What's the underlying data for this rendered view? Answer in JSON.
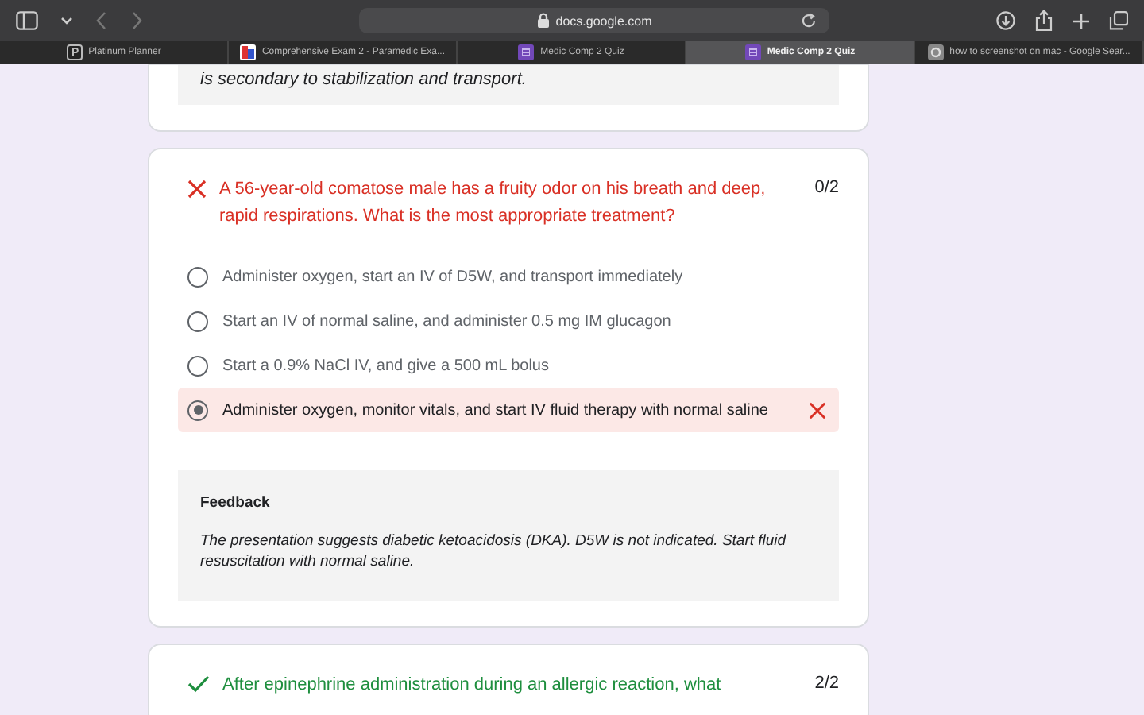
{
  "browser": {
    "url": "docs.google.com",
    "back_disabled": true,
    "forward_disabled": true
  },
  "tabs": [
    {
      "title": "Platinum Planner",
      "selected": false
    },
    {
      "title": "Comprehensive Exam 2 - Paramedic Exa...",
      "selected": false
    },
    {
      "title": "Medic Comp 2 Quiz",
      "selected": false
    },
    {
      "title": "Medic Comp 2 Quiz",
      "selected": true
    },
    {
      "title": "how to screenshot on mac - Google Sear...",
      "selected": false
    }
  ],
  "cards": [
    {
      "kind": "feedback_tail",
      "feedback": "is secondary to stabilization and transport."
    },
    {
      "kind": "question",
      "correct": false,
      "question": "A 56-year-old comatose male has a fruity odor on his breath and deep, rapid respirations. What is the most appropriate treatment?",
      "score": "0/2",
      "options": [
        {
          "label": "Administer oxygen, start an IV of D5W, and transport immediately",
          "selected": false
        },
        {
          "label": "Start an IV of normal saline, and administer 0.5 mg IM glucagon",
          "selected": false
        },
        {
          "label": "Start a 0.9% NaCl IV, and give a 500 mL bolus",
          "selected": false
        },
        {
          "label": "Administer oxygen, monitor vitals, and start IV fluid therapy with normal saline",
          "selected": true
        }
      ],
      "feedback_title": "Feedback",
      "feedback": "The presentation suggests diabetic ketoacidosis (DKA). D5W is not indicated. Start fluid resuscitation with normal saline."
    },
    {
      "kind": "question",
      "correct": true,
      "question": "After epinephrine administration during an allergic reaction, what",
      "score": "2/2"
    }
  ]
}
